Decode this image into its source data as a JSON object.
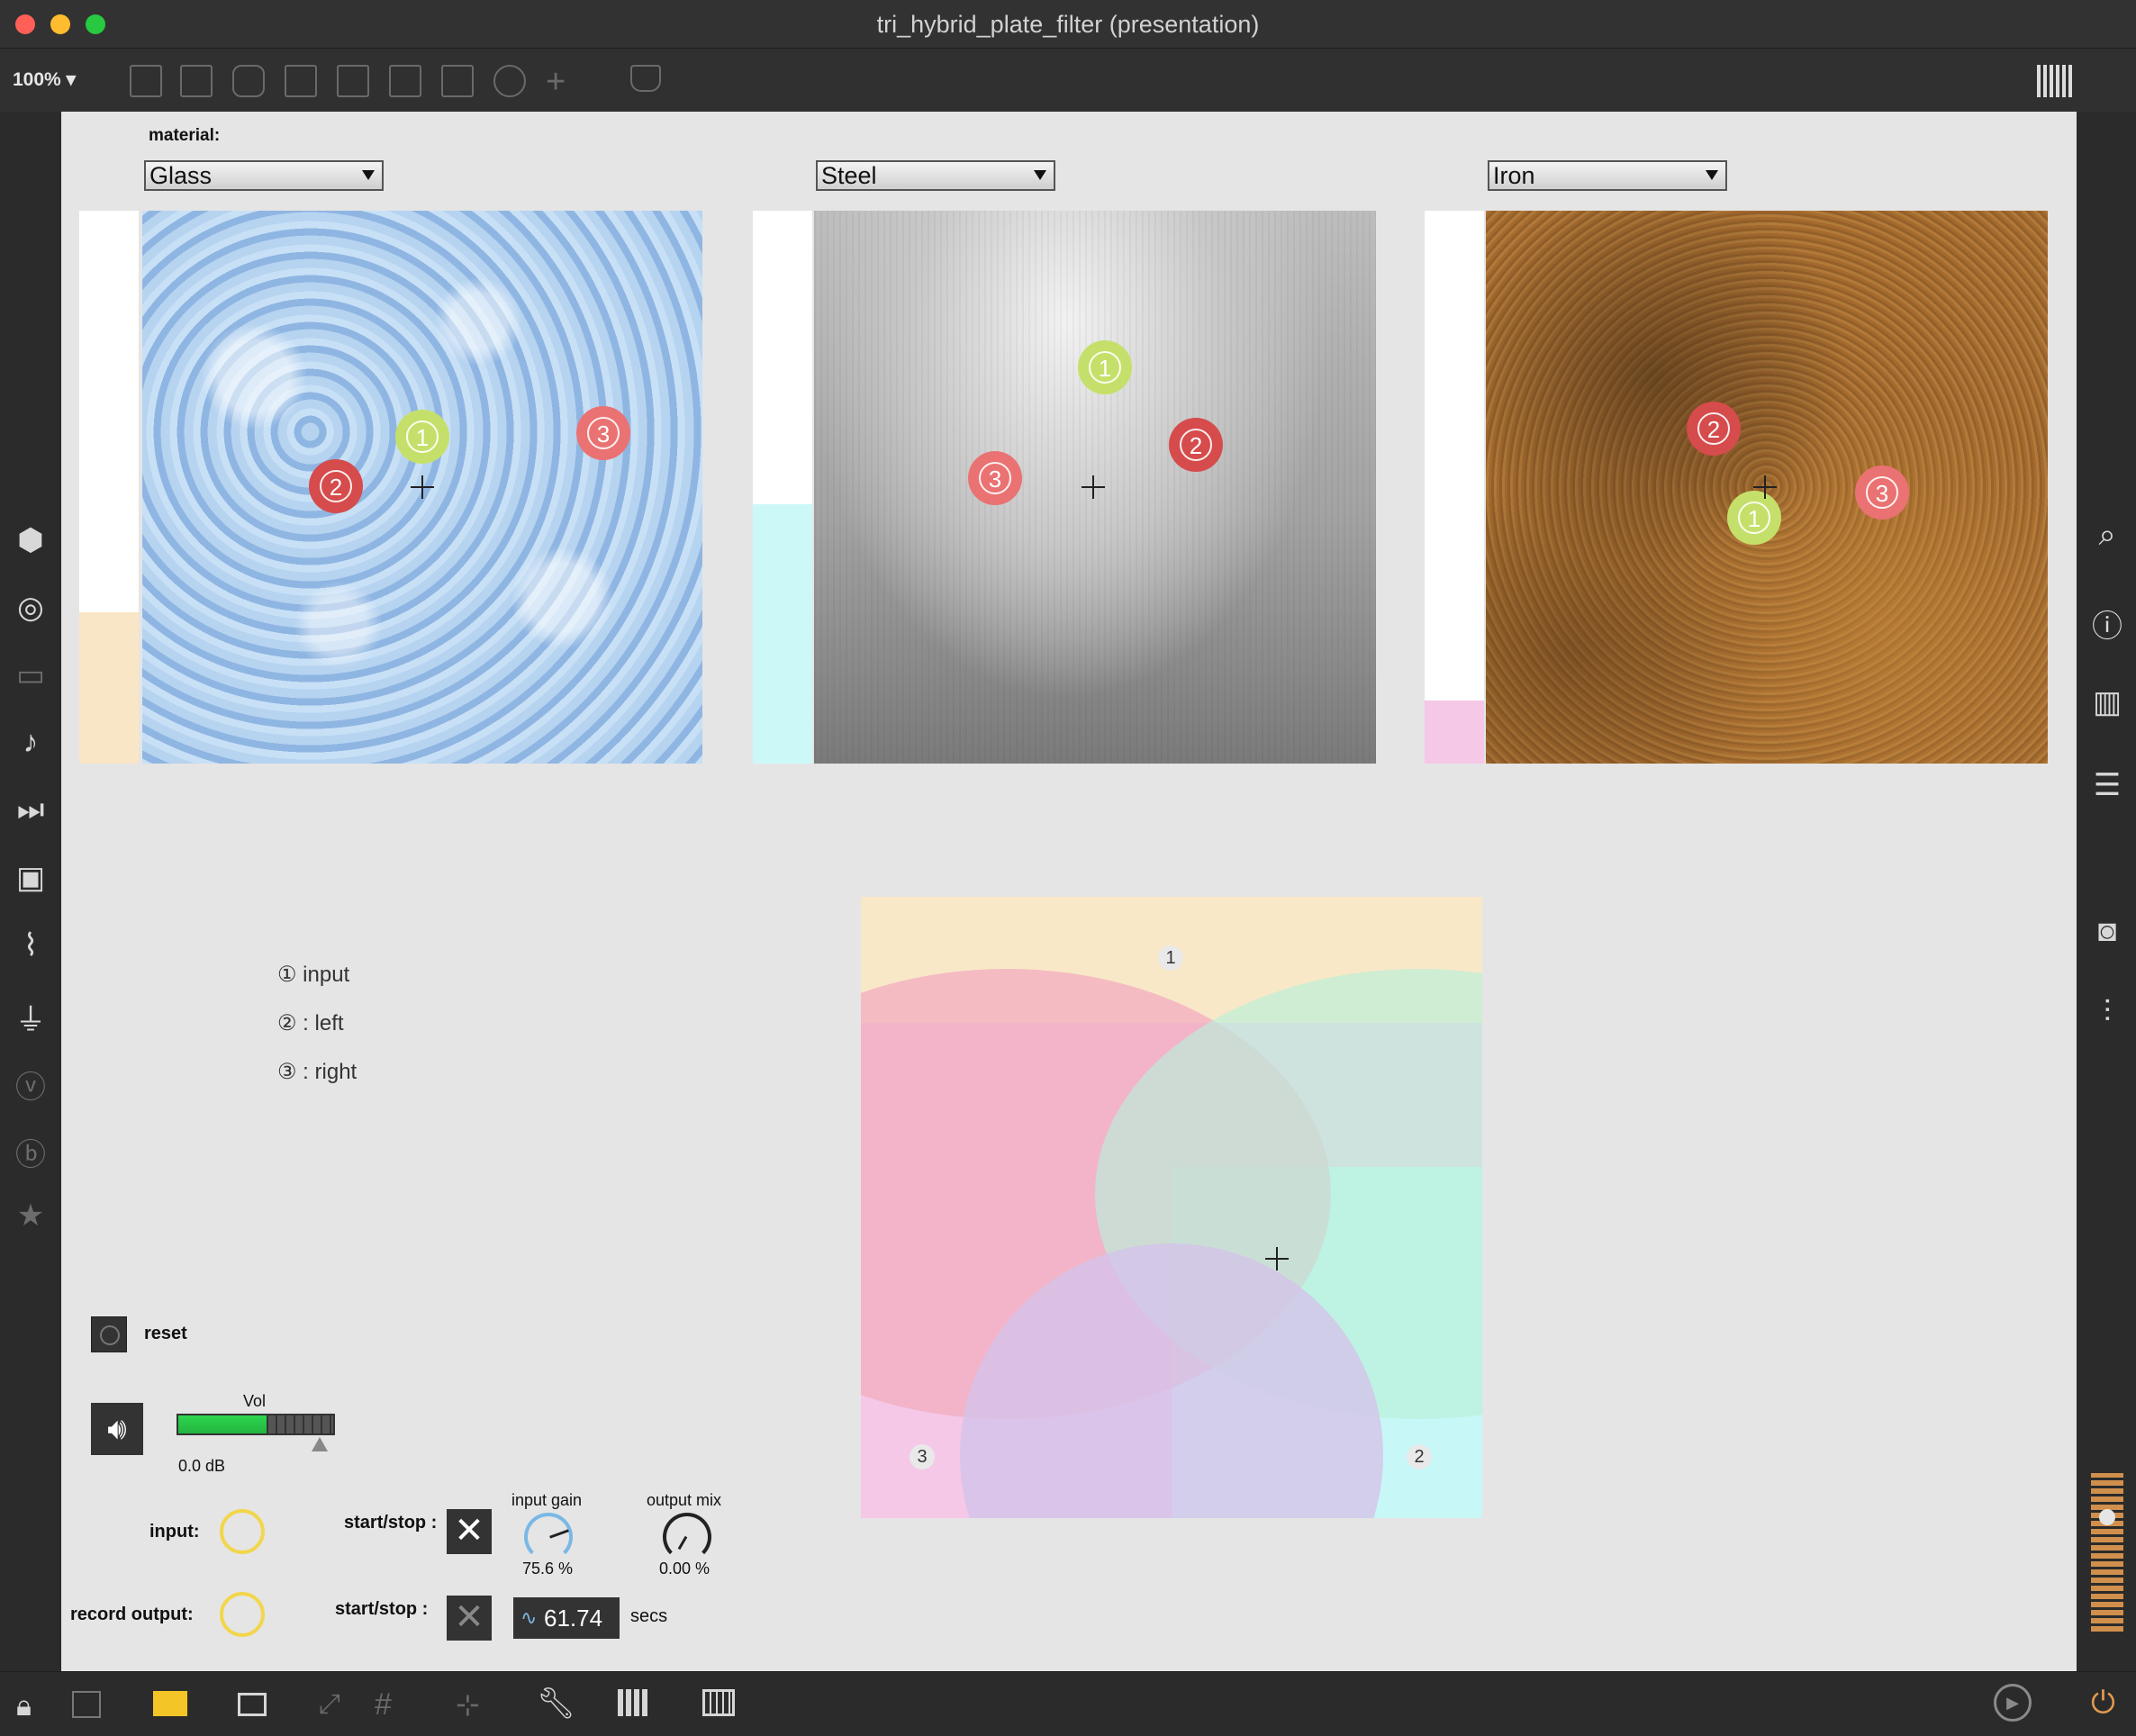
{
  "window": {
    "title": "tri_hybrid_plate_filter (presentation)"
  },
  "toolbar": {
    "zoom_label": "100% ▾"
  },
  "materials": {
    "heading": "material:",
    "panels": [
      {
        "selected": "Glass",
        "color": "#a6c9ec"
      },
      {
        "selected": "Steel",
        "color": "#9b9b9b"
      },
      {
        "selected": "Iron",
        "color": "#a46a2e"
      }
    ]
  },
  "legend": {
    "items": [
      "① input",
      "② : left",
      "③ : right"
    ]
  },
  "controls": {
    "reset_label": "reset",
    "vol_label": "Vol",
    "vol_db": "0.0 dB",
    "input_label": "input:",
    "record_label": "record output:",
    "startstop_label_1": "start/stop :",
    "startstop_label_2": "start/stop :",
    "input_gain_label": "input gain",
    "input_gain_value": "75.6 %",
    "output_mix_label": "output mix",
    "output_mix_value": "0.00 %",
    "timer_value": "61.74",
    "timer_unit": "secs"
  },
  "venn": {
    "label_1": "1",
    "label_2": "2",
    "label_3": "3"
  },
  "dot_labels": {
    "one": "1",
    "two": "2",
    "three": "3"
  },
  "colors": {
    "green_dot": "#c5e06a",
    "red_dot": "#d64b4b",
    "pink_dot": "#ea7272",
    "venn_top": "#f9e8c8",
    "venn_right": "#c8f7f7",
    "venn_left": "#f5c8e8"
  }
}
